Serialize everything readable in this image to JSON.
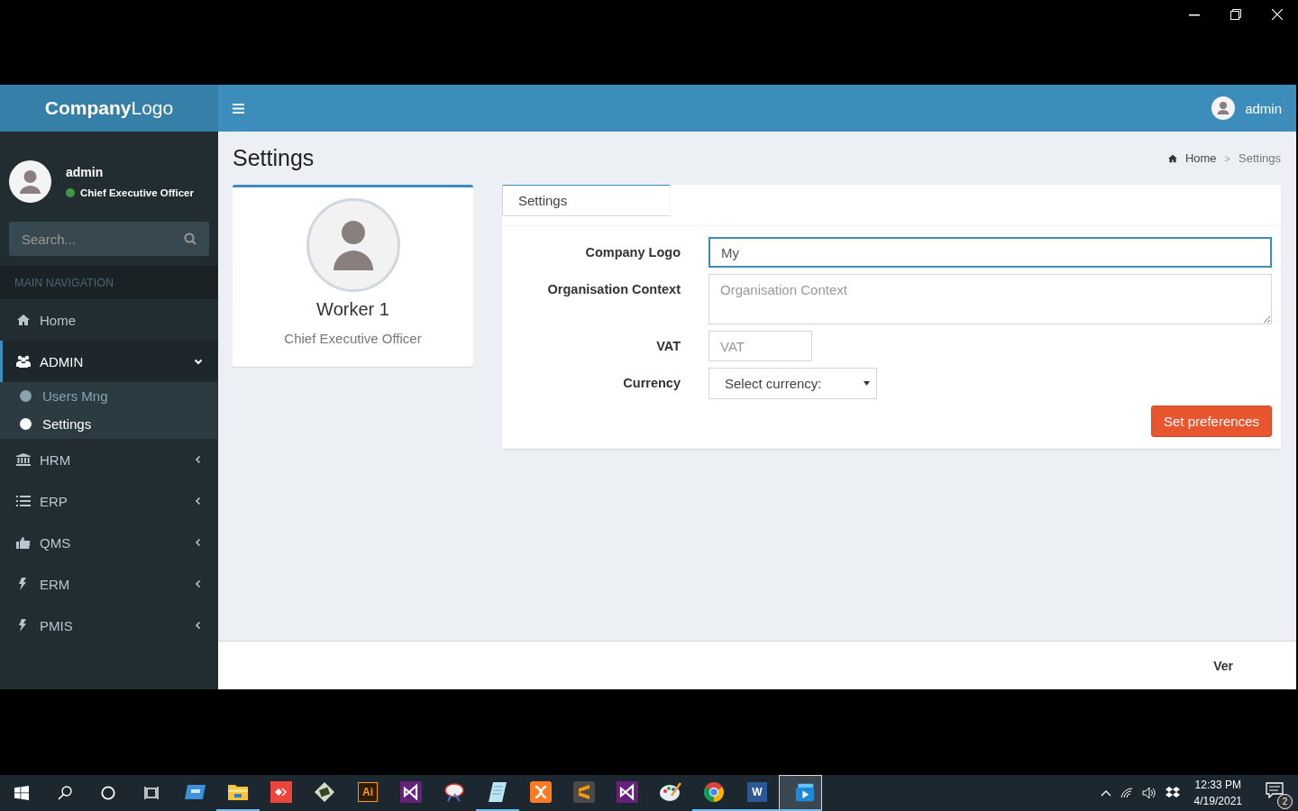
{
  "header": {
    "logo": "**Company**Logo",
    "user_menu": {
      "name": "admin"
    }
  },
  "sidebar": {
    "user": {
      "name": "admin",
      "role": "Chief Executive Officer",
      "online": true
    },
    "search": {
      "placeholder": "Search..."
    },
    "section_header": "MAIN NAVIGATION",
    "items": [
      {
        "label": "Home",
        "kind": "home",
        "submenu": false,
        "selected": false
      },
      {
        "label": "ADMIN",
        "kind": "users",
        "submenu": true,
        "expanded": true,
        "selected": true,
        "children": [
          {
            "label": "Users Mng",
            "selected": false
          },
          {
            "label": "Settings",
            "selected": true
          }
        ]
      },
      {
        "label": "HRM",
        "kind": "bank",
        "submenu": true,
        "expanded": false,
        "selected": false
      },
      {
        "label": "ERP",
        "kind": "list",
        "submenu": true,
        "expanded": false,
        "selected": false
      },
      {
        "label": "QMS",
        "kind": "thumb",
        "submenu": true,
        "expanded": false,
        "selected": false
      },
      {
        "label": "ERM",
        "kind": "bolt",
        "submenu": true,
        "expanded": false,
        "selected": false
      },
      {
        "label": "PMIS",
        "kind": "bolt",
        "submenu": true,
        "expanded": false,
        "selected": false
      }
    ]
  },
  "page": {
    "title": "Settings",
    "breadcrumb": {
      "separator": ">",
      "items": [
        {
          "label": "Home",
          "kind": "home"
        },
        {
          "label": "Settings",
          "kind": "plain"
        }
      ]
    }
  },
  "profile": {
    "name": "Worker 1",
    "role": "Chief Executive Officer"
  },
  "settings_card": {
    "tabs": [
      {
        "label": "Settings",
        "selected": true
      }
    ],
    "fields": [
      {
        "label": "Company Logo",
        "kind": "text",
        "value": "My",
        "focused": true
      },
      {
        "label": "Organisation Context",
        "kind": "textarea",
        "placeholder": "Organisation Context",
        "focused": false
      },
      {
        "label": "VAT",
        "kind": "short",
        "placeholder": "VAT",
        "focused": false
      },
      {
        "label": "Currency",
        "kind": "select",
        "value": "Select currency:",
        "focused": false
      }
    ],
    "button": "Set preferences"
  },
  "footer": {
    "text": "Ver"
  },
  "taskbar": {
    "apps": [
      {
        "kind": "blue-window",
        "running": false,
        "selected": false
      },
      {
        "kind": "folder",
        "running": true,
        "selected": false
      },
      {
        "kind": "red-arrows",
        "running": false,
        "selected": false
      },
      {
        "kind": "terminal",
        "running": false,
        "selected": false
      },
      {
        "kind": "letter-tile",
        "glyph": "Ai",
        "color": "#ff9a00",
        "running": false,
        "selected": false
      },
      {
        "kind": "vs",
        "running": false,
        "selected": false
      },
      {
        "kind": "satellite",
        "running": false,
        "selected": false
      },
      {
        "kind": "notepad",
        "running": true,
        "selected": false
      },
      {
        "kind": "xampp",
        "running": false,
        "selected": false
      },
      {
        "kind": "sublime",
        "running": false,
        "selected": false
      },
      {
        "kind": "vs",
        "running": false,
        "selected": false
      },
      {
        "kind": "palette",
        "running": false,
        "selected": false
      },
      {
        "kind": "chrome",
        "running": true,
        "selected": false
      },
      {
        "kind": "letter-tile",
        "glyph": "W",
        "color": "#2b5797",
        "running": true,
        "selected": false
      },
      {
        "kind": "player",
        "running": true,
        "selected": true
      }
    ],
    "clock": {
      "time": "12:33 PM",
      "date": "4/19/2021"
    },
    "notifications": {
      "count": "2"
    }
  }
}
